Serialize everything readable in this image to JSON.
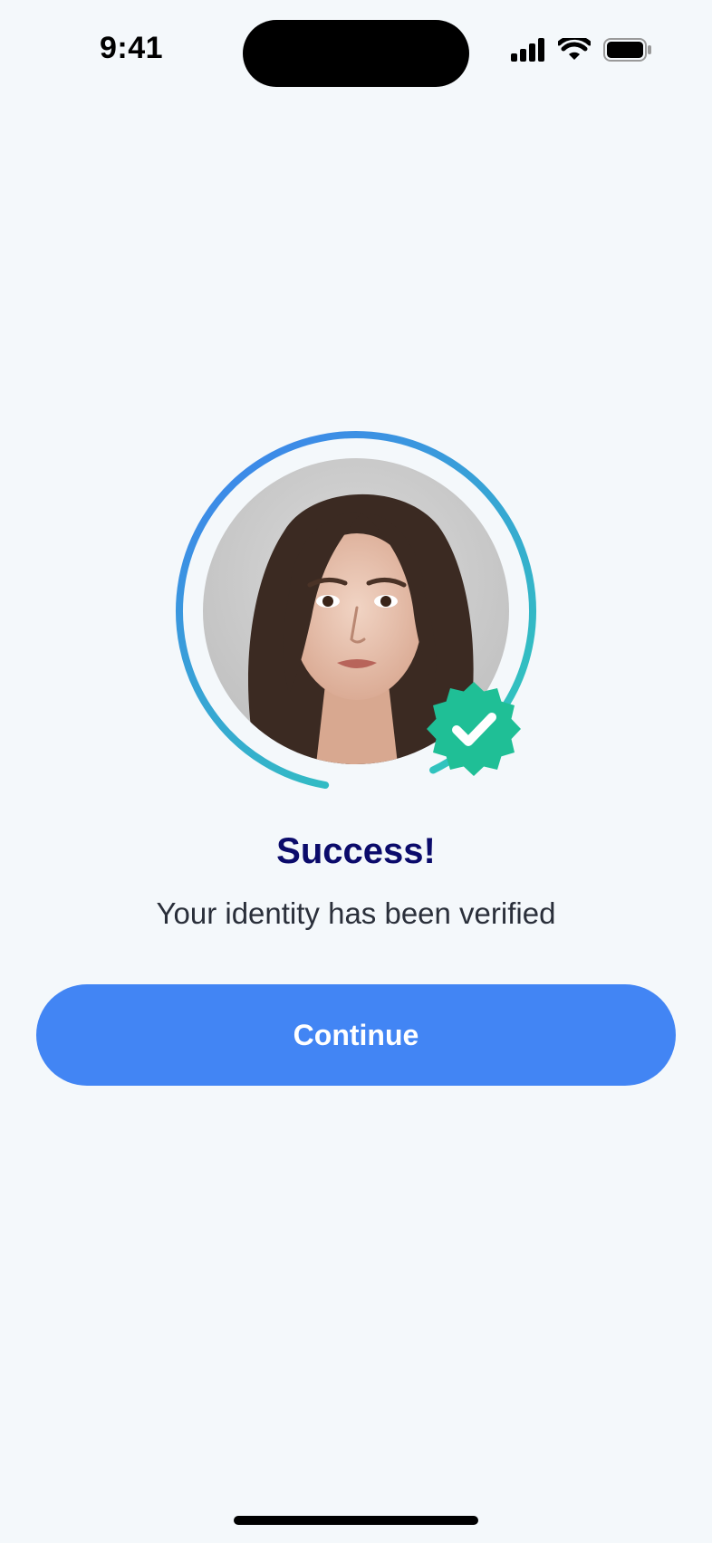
{
  "status_bar": {
    "time": "9:41",
    "icons": [
      "cellular-signal-icon",
      "wifi-icon",
      "battery-icon"
    ]
  },
  "avatar": {
    "photo_subject": "user-selfie-photo",
    "ring_progress": 0.9,
    "ring_colors": [
      "#3f7ff0",
      "#2ecfb5"
    ],
    "badge_icon": "verified-check-badge-icon",
    "badge_color": "#1fbf96"
  },
  "main": {
    "title": "Success!",
    "subtitle": "Your identity has been verified",
    "continue_label": "Continue"
  },
  "colors": {
    "background": "#f4f8fb",
    "title": "#0b0b6b",
    "button": "#4285f4"
  }
}
